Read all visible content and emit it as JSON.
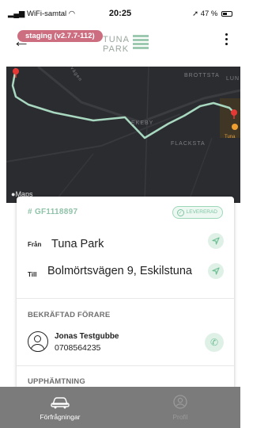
{
  "status_bar": {
    "carrier": "WiFi-samtal",
    "time": "20:25",
    "battery": "47 %"
  },
  "header": {
    "back_icon": "arrow-left-icon",
    "staging_label": "staging (v2.7.7-112)",
    "logo_top": "TUNA",
    "logo_bottom": "PARK",
    "menu_icon": "kebab-menu-icon"
  },
  "map": {
    "labels": {
      "street": "Vallbyvägen",
      "brottsta": "BROTTSTA",
      "lun": "LUN",
      "ekeby": "EKEBY",
      "flacksta": "FLACKSTA",
      "tuna": "Tuna",
      "attribution": "Maps"
    },
    "route_color": "#a8d8c0"
  },
  "order": {
    "id": "# GF1118897",
    "status": "LEVERERAD",
    "from_label": "Från",
    "from_value": "Tuna Park",
    "to_label": "Till",
    "to_value": "Bolmörtsvägen 9, Eskilstuna"
  },
  "driver_section": {
    "title": "BEKRÄFTAD FÖRARE",
    "name": "Jonas Testgubbe",
    "phone": "0708564235"
  },
  "pickup_section": {
    "title": "UPPHÄMTNING"
  },
  "tabs": [
    {
      "label": "Förfrågningar",
      "icon": "car-icon",
      "active": true
    },
    {
      "label": "Profil",
      "icon": "profile-icon",
      "active": false
    }
  ],
  "colors": {
    "accent": "#8fc2a8",
    "staging": "#cc6e80",
    "tabbar": "#7b7b7b"
  }
}
